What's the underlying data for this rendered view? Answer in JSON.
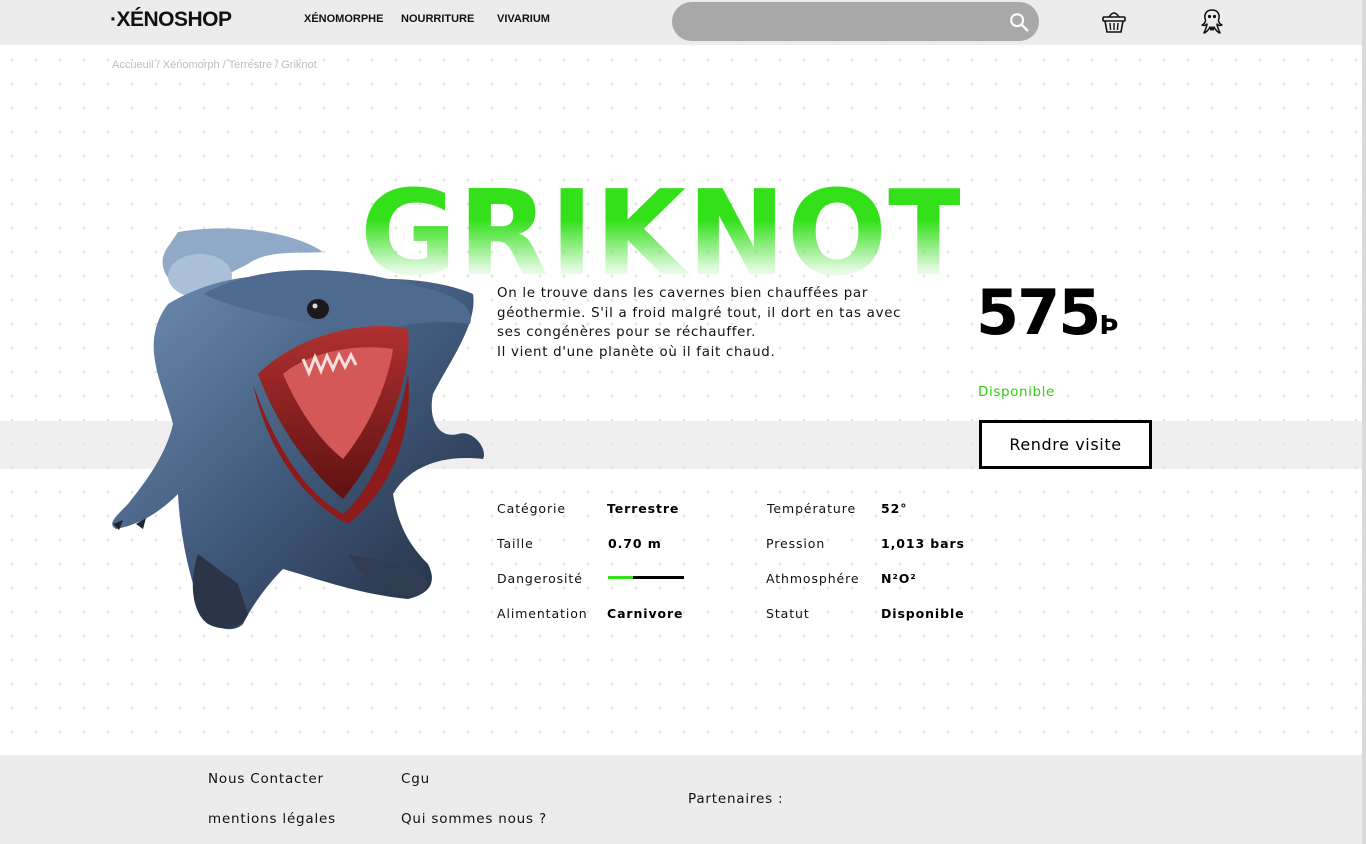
{
  "header": {
    "logo": "·XÉNOSHOP",
    "nav": [
      "XÉNOMORPHE",
      "NOURRITURE",
      "VIVARIUM"
    ],
    "search_placeholder": "",
    "icons": [
      "search-icon",
      "basket-icon",
      "user-alien-icon"
    ]
  },
  "breadcrumb": [
    "Accueuil",
    "Xénomorph",
    "Terrestre",
    "Griknot"
  ],
  "product": {
    "name": "GRIKNOT",
    "description": [
      "On le trouve dans les cavernes bien chauffées par",
      "géothermie. S'il a froid malgré tout, il dort en tas avec",
      "ses congénères pour se réchauffer.",
      "Il vient d'une planète où il fait chaud."
    ],
    "price": "575",
    "currency": "Þ",
    "availability": "Disponible",
    "visit_button": "Rendre visite",
    "specs_left": [
      {
        "label": "Catégorie",
        "value": "Terrestre"
      },
      {
        "label": "Taille",
        "value": "0.70 m"
      },
      {
        "label": "Dangerosité",
        "value": ""
      },
      {
        "label": "Alimentation",
        "value": "Carnivore"
      }
    ],
    "specs_right": [
      {
        "label": "Température",
        "value": "52°"
      },
      {
        "label": "Pression",
        "value": "1,013 bars"
      },
      {
        "label": "Athmosphére",
        "value": "N²O²"
      },
      {
        "label": "Statut",
        "value": "Disponible"
      }
    ],
    "danger_level": 0.33
  },
  "colors": {
    "accent": "#33e01a",
    "button_border": "#000000",
    "header_bg": "#ececec"
  },
  "footer": {
    "links_col1": [
      "Nous Contacter",
      "mentions légales"
    ],
    "links_col2": [
      "Cgu",
      "Qui sommes nous ?"
    ],
    "partners": "Partenaires :"
  }
}
